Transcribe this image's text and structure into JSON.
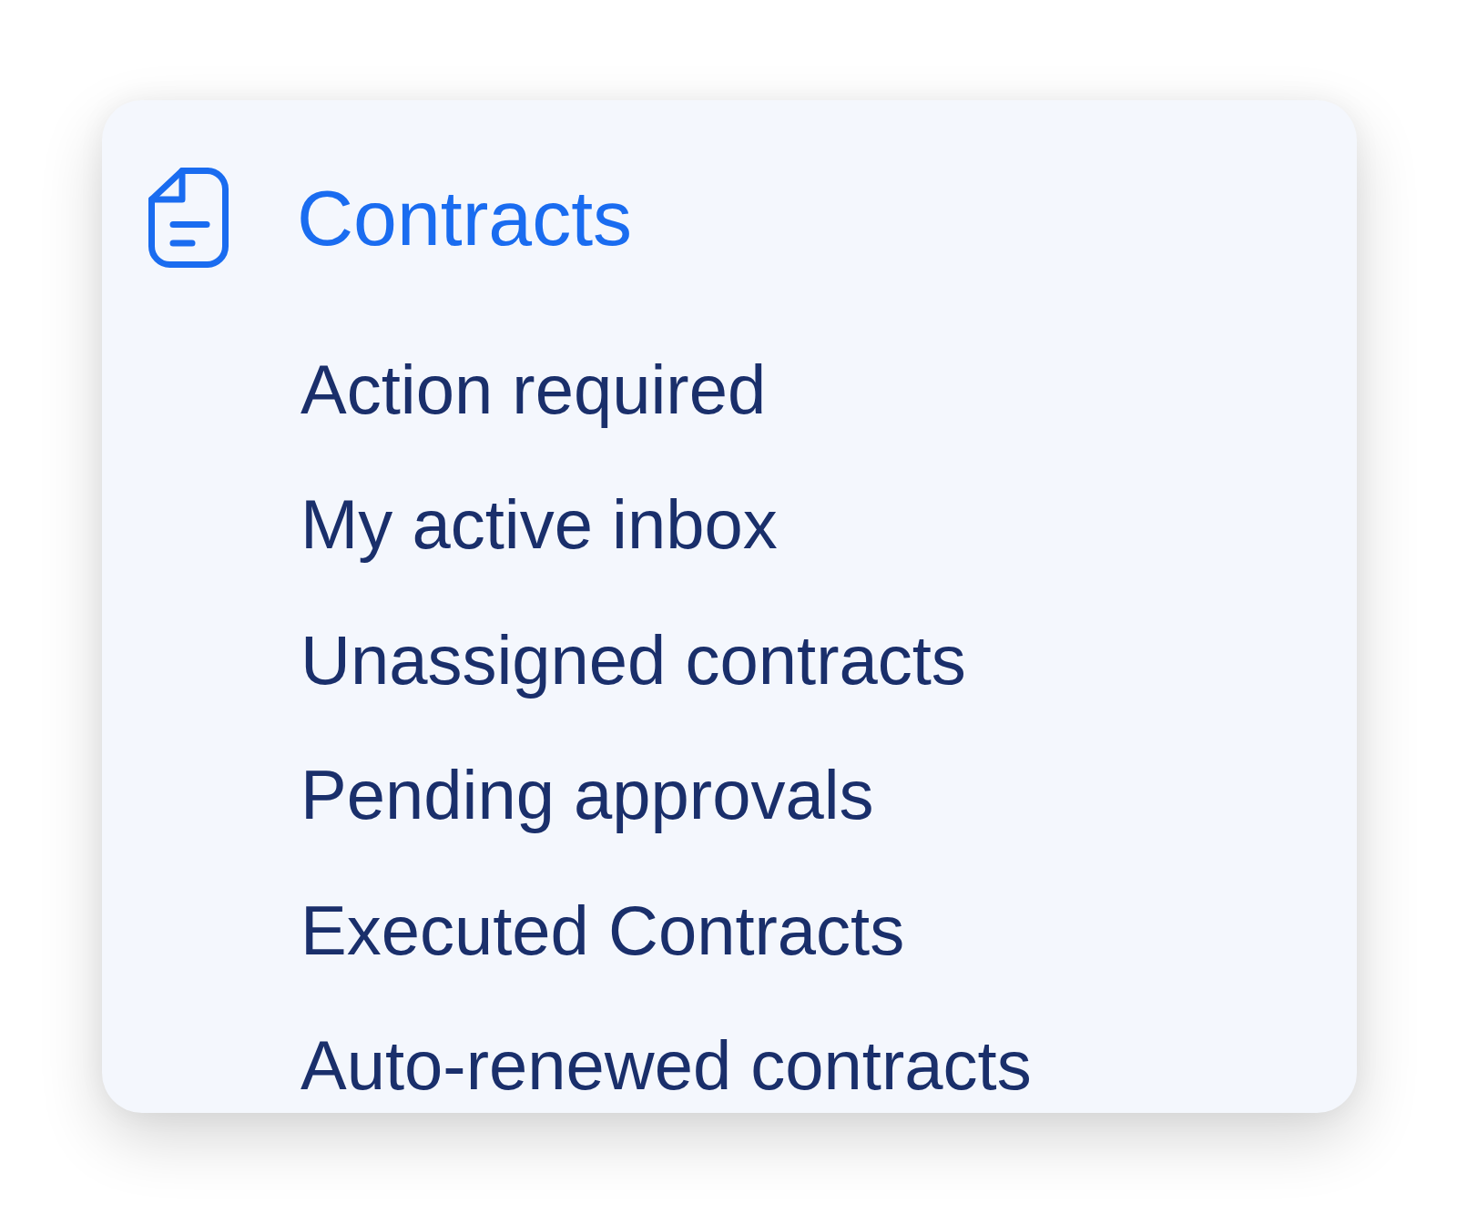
{
  "section": {
    "title": "Contracts"
  },
  "items": [
    {
      "label": "Action required"
    },
    {
      "label": "My active inbox"
    },
    {
      "label": "Unassigned contracts"
    },
    {
      "label": "Pending approvals"
    },
    {
      "label": "Executed Contracts"
    },
    {
      "label": "Auto-renewed contracts"
    }
  ]
}
